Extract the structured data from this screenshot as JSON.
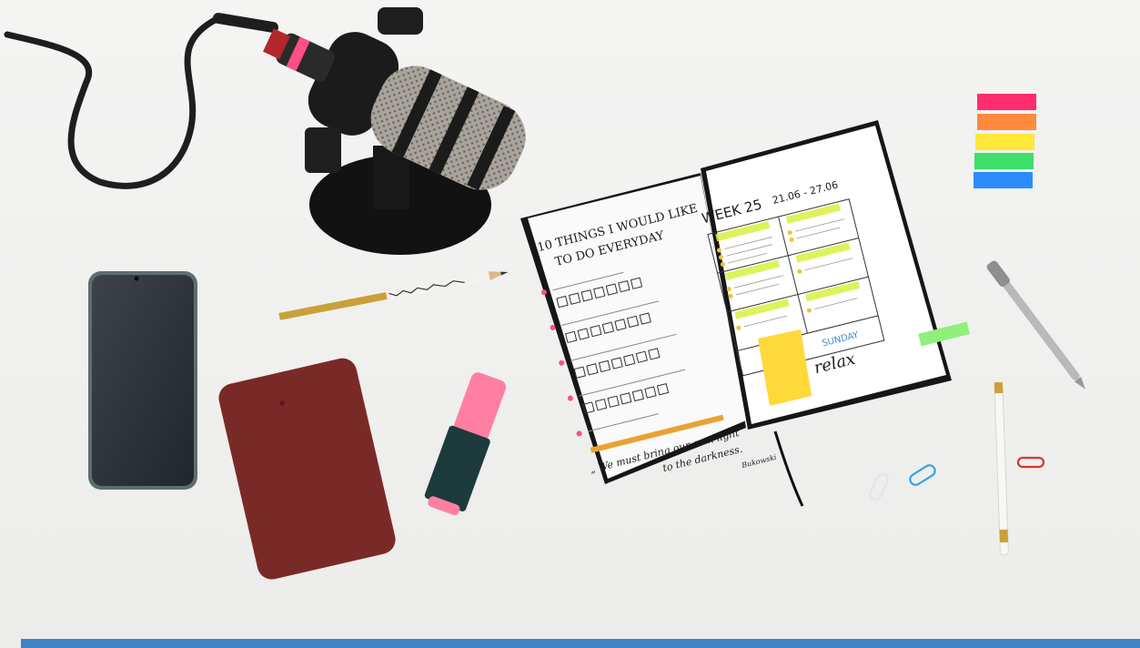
{
  "notebook": {
    "left_page": {
      "heading_line1": "10 THINGS I WOULD LIKE",
      "heading_line2": "TO DO EVERYDAY",
      "quote_line1": "„ We must bring our own light",
      "quote_line2": "to the darkness.",
      "quote_author": "Bukowski"
    },
    "right_page": {
      "week_title": "WEEK 25",
      "date_range": "21.06 - 27.06",
      "sunday_label": "SUNDAY",
      "relax_text": "relax"
    }
  },
  "colors": {
    "background": "#f3f3f2",
    "bottom_bar": "#3f83c6",
    "sticky_flags": [
      "#ff2d6e",
      "#ff8a3d",
      "#ffe83a",
      "#3ee06a",
      "#2b8cff"
    ],
    "powerbank": "#7a2a26",
    "highlighter_cap": "#ff7fa2",
    "sticky_note": "#ffd83a"
  }
}
